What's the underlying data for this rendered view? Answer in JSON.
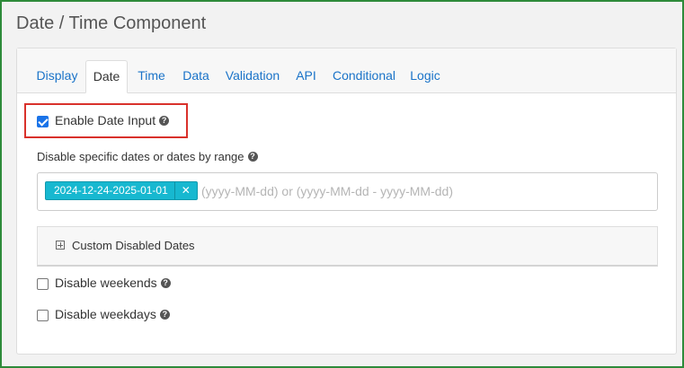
{
  "page": {
    "title": "Date / Time Component"
  },
  "tabs": [
    {
      "label": "Display"
    },
    {
      "label": "Date"
    },
    {
      "label": "Time"
    },
    {
      "label": "Data"
    },
    {
      "label": "Validation"
    },
    {
      "label": "API"
    },
    {
      "label": "Conditional"
    },
    {
      "label": "Logic"
    }
  ],
  "active_tab": "Date",
  "enable_date_input": {
    "label": "Enable Date Input",
    "checked": true
  },
  "disable_dates": {
    "label": "Disable specific dates or dates by range",
    "tags": [
      "2024-12-24-2025-01-01"
    ],
    "placeholder": "(yyyy-MM-dd) or (yyyy-MM-dd - yyyy-MM-dd)"
  },
  "custom_disabled_dates": {
    "label": "Custom Disabled Dates"
  },
  "disable_weekends": {
    "label": "Disable weekends",
    "checked": false
  },
  "disable_weekdays": {
    "label": "Disable weekdays",
    "checked": false
  },
  "colors": {
    "accent": "#1a73c8",
    "tag": "#17b8d0",
    "highlight": "#d9312b",
    "frame": "#2e8b3a"
  },
  "icons": {
    "help": "question-circle-icon",
    "remove": "close-icon",
    "expand": "plus-square-icon"
  }
}
